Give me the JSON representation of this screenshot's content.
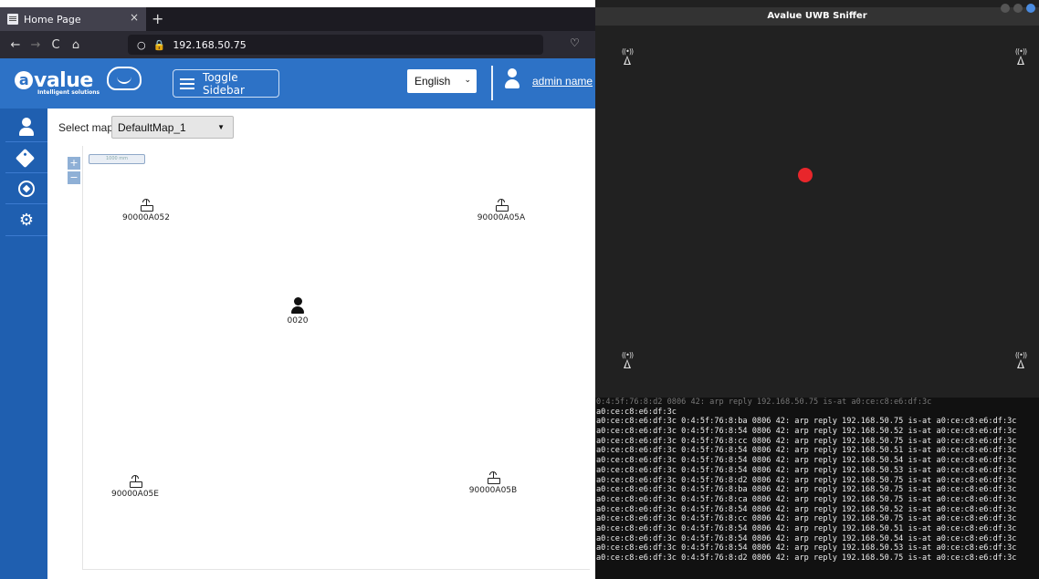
{
  "browser": {
    "tab": {
      "title": "Home Page",
      "close": "×"
    },
    "new_tab": "+",
    "nav": {
      "back": "←",
      "forward": "→",
      "reload": "C",
      "home": "⌂"
    },
    "url": "192.168.50.75",
    "url_icons": {
      "shield": "○",
      "lock": "🔒"
    },
    "bookmark_star": "☆",
    "pocket": "♡"
  },
  "app": {
    "logo_text": "value",
    "logo_letter": "a",
    "logo_sub": "Intelligent solutions",
    "toggle_sidebar": "Toggle Sidebar",
    "language": {
      "selected": "English"
    },
    "user": {
      "name": "admin name"
    },
    "select_map_label": "Select map",
    "map_selected": "DefaultMap_1",
    "zoom_in": "+",
    "zoom_out": "−",
    "scale_label": "1000 mm",
    "anchors": [
      {
        "id": "90000A052"
      },
      {
        "id": "90000A05A"
      },
      {
        "id": "90000A05E"
      },
      {
        "id": "90000A05B"
      }
    ],
    "tag": {
      "id": "0020"
    }
  },
  "sniffer": {
    "title": "Avalue UWB Sniffer",
    "dot_color": "#e8262b"
  },
  "terminal": {
    "lines": [
      "0:4:5f:76:8:d2 0806 42: arp reply 192.168.50.75 is-at a0:ce:c8:e6:df:3c",
      "a0:ce:c8:e6:df:3c",
      "a0:ce:c8:e6:df:3c 0:4:5f:76:8:ba 0806 42: arp reply 192.168.50.75 is-at a0:ce:c8:e6:df:3c",
      "a0:ce:c8:e6:df:3c 0:4:5f:76:8:54 0806 42: arp reply 192.168.50.52 is-at a0:ce:c8:e6:df:3c",
      "a0:ce:c8:e6:df:3c 0:4:5f:76:8:cc 0806 42: arp reply 192.168.50.75 is-at a0:ce:c8:e6:df:3c",
      "a0:ce:c8:e6:df:3c 0:4:5f:76:8:54 0806 42: arp reply 192.168.50.51 is-at a0:ce:c8:e6:df:3c",
      "a0:ce:c8:e6:df:3c 0:4:5f:76:8:54 0806 42: arp reply 192.168.50.54 is-at a0:ce:c8:e6:df:3c",
      "a0:ce:c8:e6:df:3c 0:4:5f:76:8:54 0806 42: arp reply 192.168.50.53 is-at a0:ce:c8:e6:df:3c",
      "a0:ce:c8:e6:df:3c 0:4:5f:76:8:d2 0806 42: arp reply 192.168.50.75 is-at a0:ce:c8:e6:df:3c",
      "a0:ce:c8:e6:df:3c 0:4:5f:76:8:ba 0806 42: arp reply 192.168.50.75 is-at a0:ce:c8:e6:df:3c",
      "a0:ce:c8:e6:df:3c 0:4:5f:76:8:ca 0806 42: arp reply 192.168.50.75 is-at a0:ce:c8:e6:df:3c",
      "a0:ce:c8:e6:df:3c 0:4:5f:76:8:54 0806 42: arp reply 192.168.50.52 is-at a0:ce:c8:e6:df:3c",
      "a0:ce:c8:e6:df:3c 0:4:5f:76:8:cc 0806 42: arp reply 192.168.50.75 is-at a0:ce:c8:e6:df:3c",
      "a0:ce:c8:e6:df:3c 0:4:5f:76:8:54 0806 42: arp reply 192.168.50.51 is-at a0:ce:c8:e6:df:3c",
      "a0:ce:c8:e6:df:3c 0:4:5f:76:8:54 0806 42: arp reply 192.168.50.54 is-at a0:ce:c8:e6:df:3c",
      "a0:ce:c8:e6:df:3c 0:4:5f:76:8:54 0806 42: arp reply 192.168.50.53 is-at a0:ce:c8:e6:df:3c",
      "a0:ce:c8:e6:df:3c 0:4:5f:76:8:d2 0806 42: arp reply 192.168.50.75 is-at a0:ce:c8:e6:df:3c"
    ]
  }
}
